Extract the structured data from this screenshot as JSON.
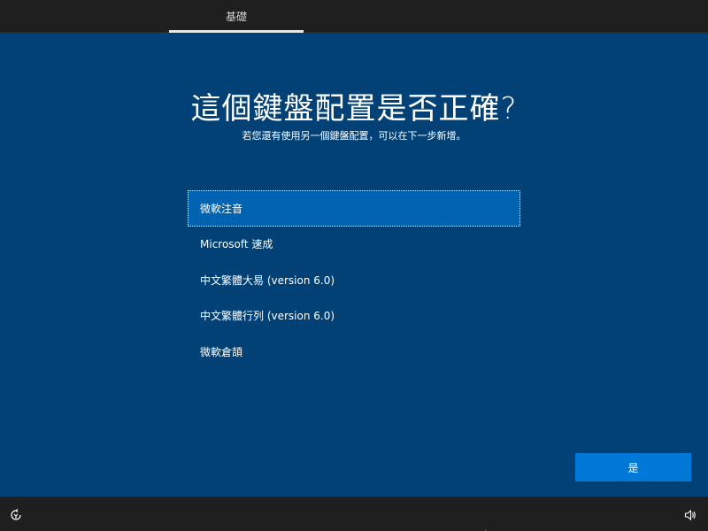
{
  "header": {
    "tab_label": "基礎"
  },
  "main": {
    "title": "這個鍵盤配置是否正確?",
    "subtitle": "若您還有使用另一個鍵盤配置，可以在下一步新增。",
    "layouts": [
      {
        "label": "微軟注音",
        "selected": true
      },
      {
        "label": "Microsoft 速成",
        "selected": false
      },
      {
        "label": "中文繁體大易 (version 6.0)",
        "selected": false
      },
      {
        "label": "中文繁體行列 (version 6.0)",
        "selected": false
      },
      {
        "label": "微軟倉頡",
        "selected": false
      }
    ],
    "yes_label": "是"
  },
  "footer": {
    "accessibility_icon": "ease-of-access-icon",
    "volume_icon": "volume-icon"
  },
  "colors": {
    "background": "#024175",
    "selected_item": "#0063b1",
    "primary_button": "#0078d7",
    "bar": "#1f1f1f"
  }
}
